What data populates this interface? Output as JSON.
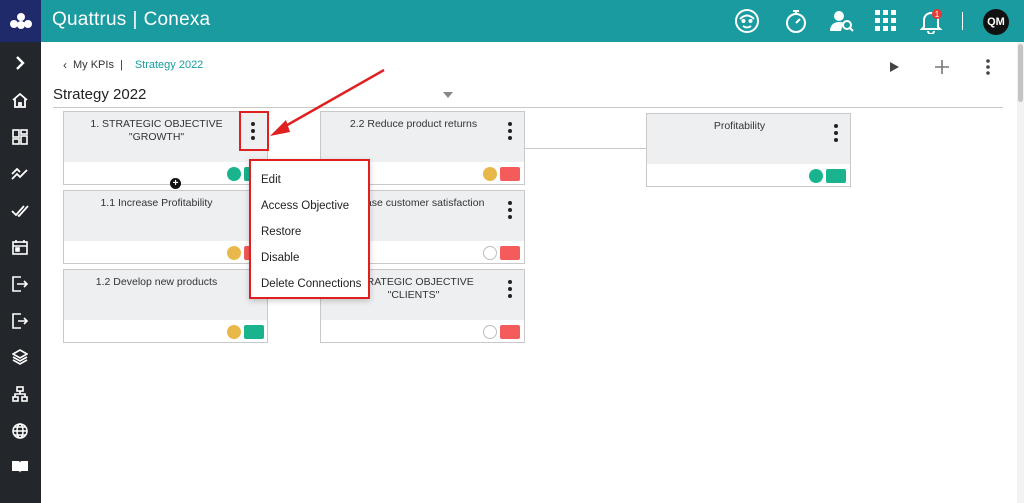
{
  "app": {
    "brand_left": "Quattrus",
    "brand_sep": "|",
    "brand_right": "Conexa",
    "avatar_initials": "QM",
    "notification_count": "1",
    "colors": {
      "header": "#1a9ba0",
      "logo_bg": "#1f2a6b",
      "sidebar": "#23272b",
      "green": "#19b38e",
      "red": "#f45b5b",
      "yellow": "#e8b84a",
      "highlight": "#e02020"
    }
  },
  "header_icons": [
    "face-mask-icon",
    "stopwatch-icon",
    "user-search-icon",
    "app-grid-icon",
    "bell-icon"
  ],
  "sidebar": {
    "items": [
      "expand-icon",
      "home-icon",
      "dashboard-icon",
      "trend-icon",
      "double-check-icon",
      "calendar-icon",
      "import-icon",
      "export-icon",
      "layers-icon",
      "hierarchy-icon",
      "globe-icon",
      "book-icon"
    ]
  },
  "breadcrumb": {
    "back": "My KPIs",
    "separator": "|",
    "current": "Strategy 2022"
  },
  "page": {
    "title": "Strategy 2022"
  },
  "cards": [
    {
      "label": "1. STRATEGIC OBJECTIVE \"GROWTH\"",
      "status": "green",
      "kpi": "green"
    },
    {
      "label": "1.1 Increase Profitability",
      "status": "yellow",
      "kpi": "red"
    },
    {
      "label": "1.2 Develop new products",
      "status": "yellow",
      "kpi": "green"
    },
    {
      "label": "2.2 Reduce product returns",
      "status": "yellow",
      "kpi": "red"
    },
    {
      "label": "Increase customer satisfaction",
      "status": "empty",
      "kpi": "red"
    },
    {
      "label": "STRATEGIC OBJECTIVE \"CLIENTS\"",
      "status": "empty",
      "kpi": "red"
    },
    {
      "label": "Profitability",
      "status": "green",
      "kpi": "green"
    }
  ],
  "context_menu": {
    "items": [
      "Edit",
      "Access Objective",
      "Restore",
      "Disable",
      "Delete Connections"
    ]
  },
  "add_connector_symbol": "+"
}
